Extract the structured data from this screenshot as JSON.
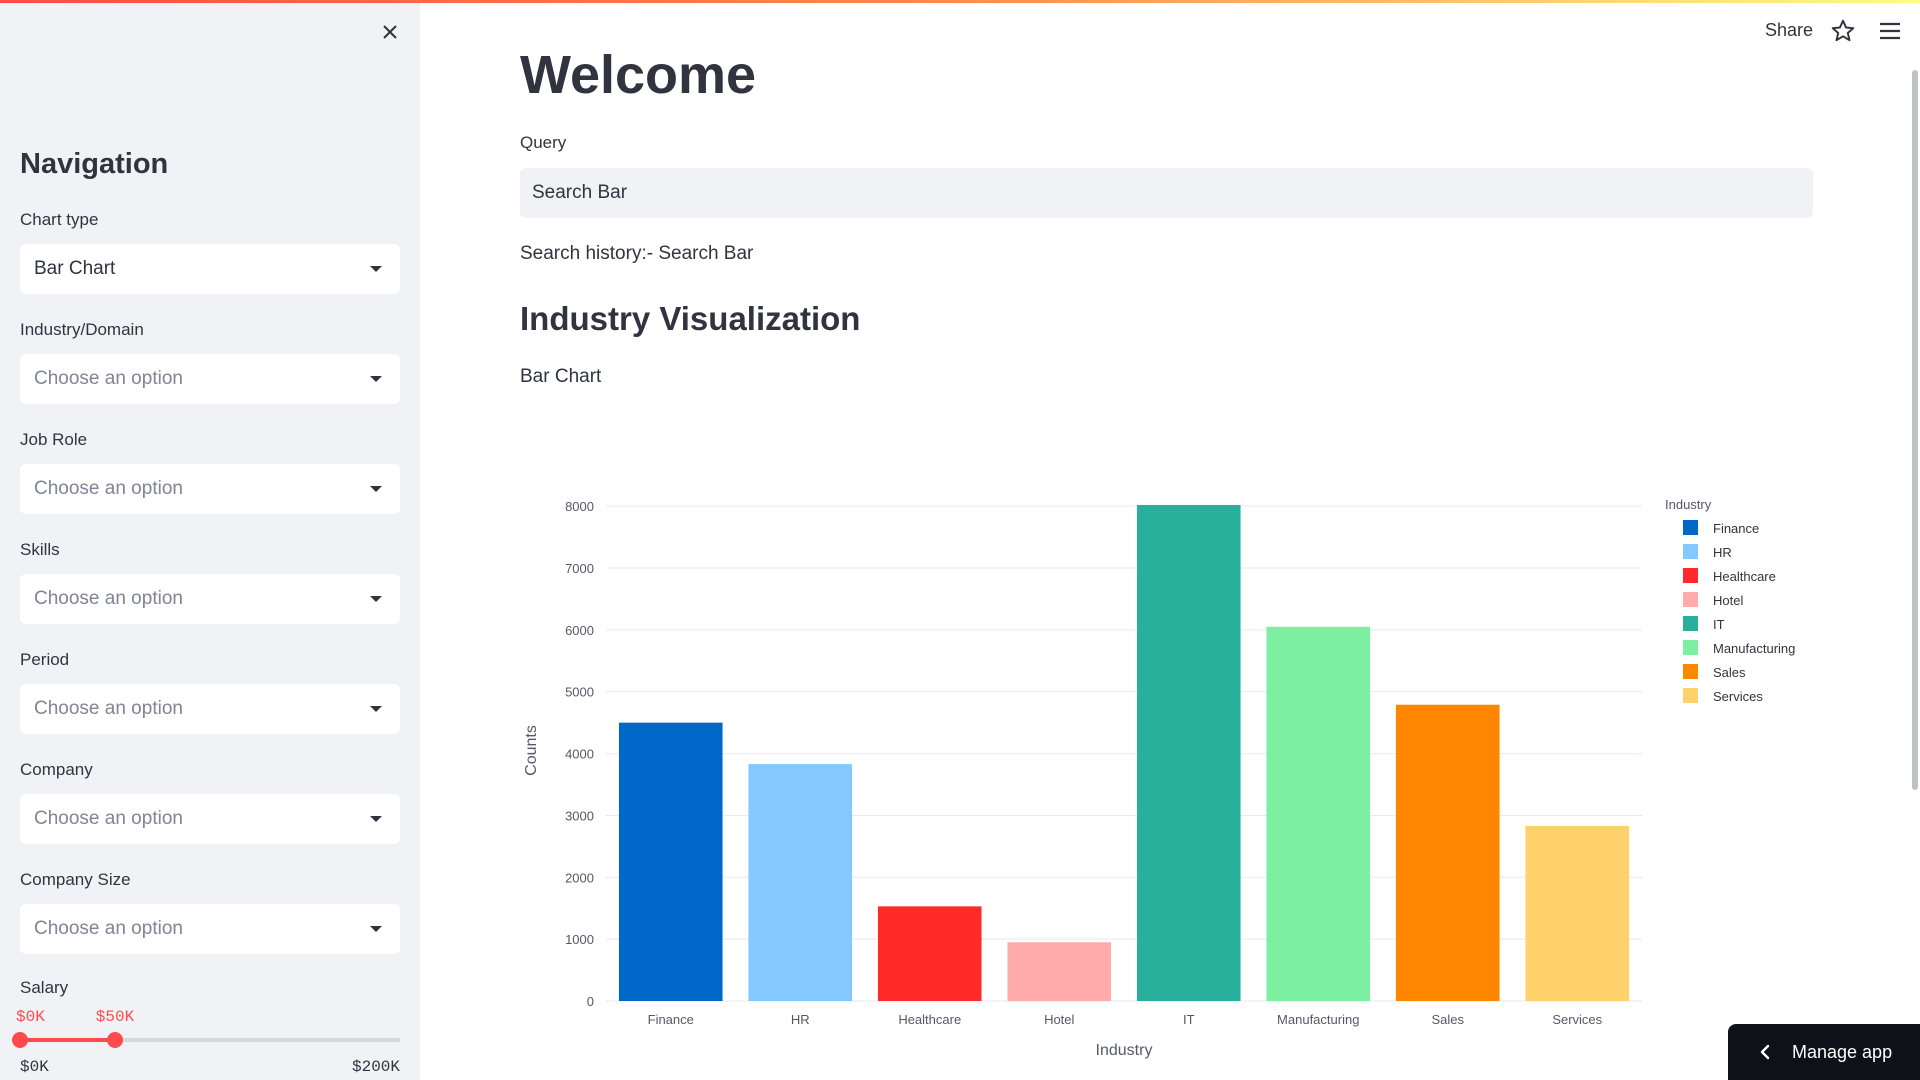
{
  "app": {
    "accent": "#ff4b4b"
  },
  "sidebar": {
    "title": "Navigation",
    "fields": [
      {
        "label": "Chart type",
        "value": "Bar Chart",
        "is_placeholder": false
      },
      {
        "label": "Industry/Domain",
        "value": "Choose an option",
        "is_placeholder": true
      },
      {
        "label": "Job Role",
        "value": "Choose an option",
        "is_placeholder": true
      },
      {
        "label": "Skills",
        "value": "Choose an option",
        "is_placeholder": true
      },
      {
        "label": "Period",
        "value": "Choose an option",
        "is_placeholder": true
      },
      {
        "label": "Company",
        "value": "Choose an option",
        "is_placeholder": true
      },
      {
        "label": "Company Size",
        "value": "Choose an option",
        "is_placeholder": true
      }
    ],
    "salary": {
      "label": "Salary",
      "low_label": "$0K",
      "high_label": "$50K",
      "min_label": "$0K",
      "max_label": "$200K",
      "low_value": 0,
      "high_value": 50,
      "min": 0,
      "max": 200
    }
  },
  "header": {
    "share_label": "Share"
  },
  "main": {
    "title": "Welcome",
    "query_label": "Query",
    "query_value": "Search Bar",
    "history_text": "Search history:- Search Bar",
    "section_title": "Industry Visualization",
    "chart_caption": "Bar Chart"
  },
  "manage_app": {
    "label": "Manage app"
  },
  "chart_data": {
    "type": "bar",
    "categories": [
      "Finance",
      "HR",
      "Healthcare",
      "Hotel",
      "IT",
      "Manufacturing",
      "Sales",
      "Services"
    ],
    "values": [
      4500,
      3830,
      1530,
      950,
      8020,
      6050,
      4790,
      2830
    ],
    "colors": [
      "#0068c9",
      "#83c9ff",
      "#ff2b2b",
      "#ffabab",
      "#29b09d",
      "#7defa1",
      "#ff8700",
      "#ffd16a"
    ],
    "xlabel": "Industry",
    "ylabel": "Counts",
    "ylim": [
      0,
      8100
    ],
    "yticks": [
      0,
      1000,
      2000,
      3000,
      4000,
      5000,
      6000,
      7000,
      8000
    ],
    "legend_title": "Industry",
    "legend_position": "right",
    "grid": true
  }
}
